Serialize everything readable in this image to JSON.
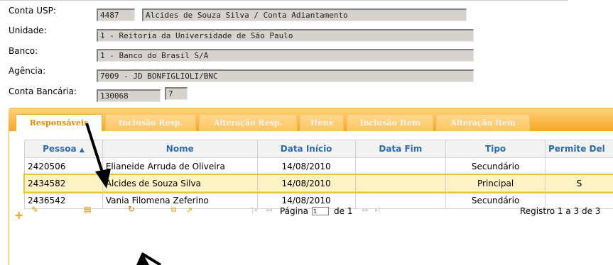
{
  "form": {
    "conta_usp_label": "Conta USP:",
    "conta_usp_code": "4487",
    "conta_usp_name": "Alcides de Souza Silva / Conta Adiantamento",
    "unidade_label": "Unidade:",
    "unidade_value": "1 - Reitoria da Universidade de São Paulo",
    "banco_label": "Banco:",
    "banco_value": "1 - Banco do Brasil S/A",
    "agencia_label": "Agência:",
    "agencia_value": "7009 - JD BONFIGLIOLI/BNC",
    "conta_bancaria_label": "Conta Bancária:",
    "conta_bancaria_number": "130068",
    "conta_bancaria_digit": "7"
  },
  "tabs": [
    {
      "label": "Responsáveis",
      "active": true
    },
    {
      "label": "Inclusão Resp."
    },
    {
      "label": "Alteração Resp."
    },
    {
      "label": "Itens"
    },
    {
      "label": "Inclusão Item"
    },
    {
      "label": "Alteração Item"
    }
  ],
  "grid": {
    "columns": [
      "Pessoa",
      "Nome",
      "Data Início",
      "Data Fim",
      "Tipo",
      "Permite Del"
    ],
    "rows": [
      {
        "pessoa": "2420506",
        "nome": "Elianeide Arruda de Oliveira",
        "inicio": "14/08/2010",
        "fim": "",
        "tipo": "Secundário",
        "permite": ""
      },
      {
        "pessoa": "2434582",
        "nome": "Alcides de Souza Silva",
        "inicio": "14/08/2010",
        "fim": "",
        "tipo": "Principal",
        "permite": "S",
        "selected": true
      },
      {
        "pessoa": "2436542",
        "nome": "Vania Filomena Zeferino",
        "inicio": "14/08/2010",
        "fim": "",
        "tipo": "Secundário",
        "permite": ""
      }
    ]
  },
  "pager": {
    "page_label": "Página",
    "page_value": "1",
    "of_label": "de 1",
    "records": "Registro 1 a 3 de 3"
  },
  "toolbar_icons": [
    "plus-icon",
    "pencil-icon",
    "list-icon",
    "refresh-icon",
    "window-icon",
    "popout-icon",
    "first-page-icon",
    "prev-page-icon",
    "next-page-icon",
    "last-page-icon"
  ],
  "colors": {
    "accent": "#f5a623",
    "header_text": "#2b6bb0",
    "selected_row": "#fff2c2",
    "field_bg": "#d6d3ce"
  }
}
